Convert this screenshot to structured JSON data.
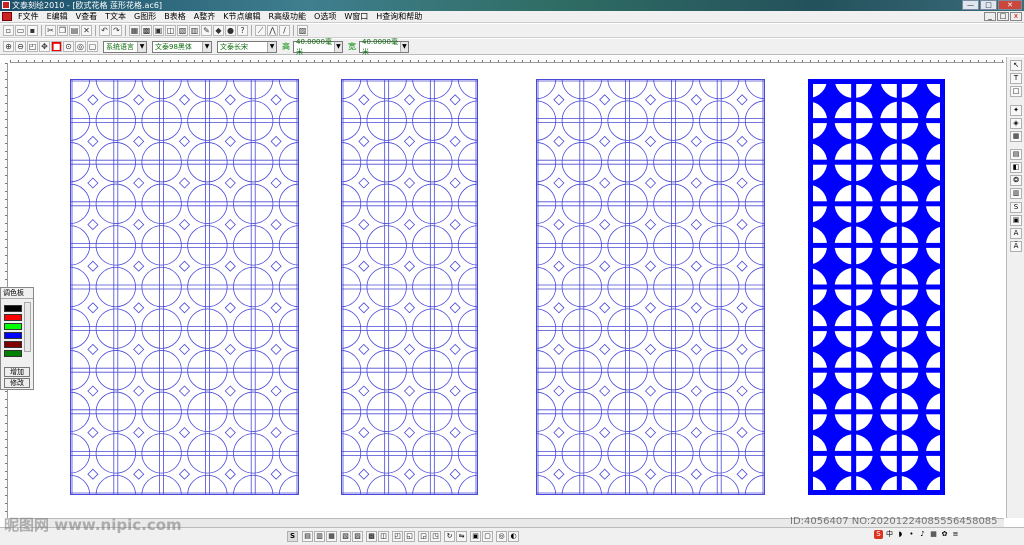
{
  "window": {
    "title": "文泰刻绘2010 - [欧式花格 莲形花格.ac6]",
    "controls": [
      "—",
      "□",
      "✕"
    ]
  },
  "menu": {
    "items": [
      "F文件",
      "E编辑",
      "V查看",
      "T文本",
      "G图形",
      "B表格",
      "A整齐",
      "K节点编辑",
      "R高级功能",
      "O选项",
      "W窗口",
      "H查询和帮助"
    ],
    "mdi_controls": [
      "_",
      "□",
      "x"
    ]
  },
  "toolbar2": {
    "language": "系统语言",
    "font": "文泰98黑体",
    "style": "文泰长宋",
    "width_label": "高",
    "width_value": "40.0000毫米",
    "height_label": "宽",
    "height_value": "40.0000毫米"
  },
  "palette": {
    "title": "调色板",
    "colors": [
      "#000000",
      "#ff0000",
      "#00ff00",
      "#0000ff",
      "#800000",
      "#008000"
    ],
    "add_label": "增加",
    "modify_label": "修改"
  },
  "panels": [
    {
      "style": "outline",
      "color": "#4a4ad8",
      "cols": 5,
      "rows": 10
    },
    {
      "style": "outline",
      "color": "#4a4ad8",
      "cols": 3,
      "rows": 10
    },
    {
      "style": "outline",
      "color": "#4a4ad8",
      "cols": 5,
      "rows": 10
    },
    {
      "style": "filled",
      "color": "#0000ff",
      "cols": 3,
      "rows": 10
    }
  ],
  "watermarks": {
    "left": "昵图网 www.nipic.com",
    "right": "ID:4056407 NO:20201224085556458085"
  },
  "colors": {
    "accent_blue": "#0000ff",
    "outline_blue": "#4a4ad8"
  }
}
